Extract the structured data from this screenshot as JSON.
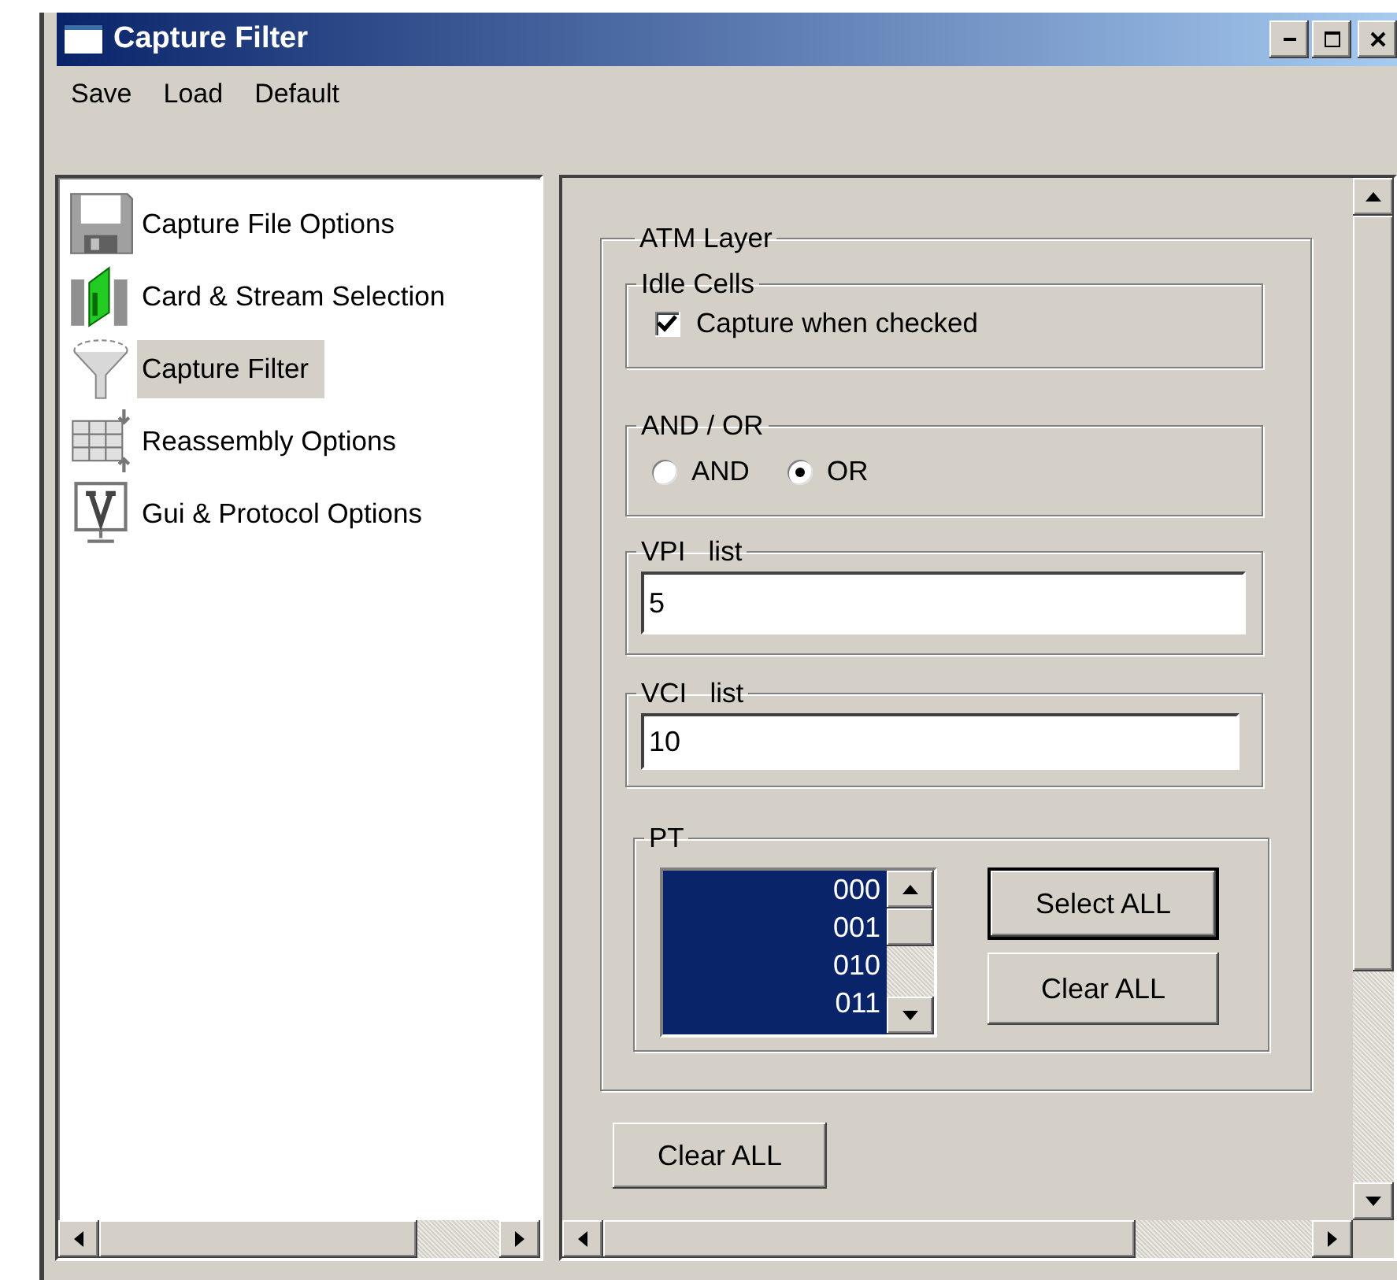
{
  "window": {
    "title": "Capture Filter"
  },
  "menu": [
    {
      "label": "Save"
    },
    {
      "label": "Load"
    },
    {
      "label": "Default"
    }
  ],
  "nav": [
    {
      "label": "Capture File Options",
      "kind": "floppy",
      "selected": false
    },
    {
      "label": "Card & Stream Selection",
      "kind": "cards",
      "selected": false
    },
    {
      "label": "Capture Filter",
      "kind": "funnel",
      "selected": true
    },
    {
      "label": "Reassembly Options",
      "kind": "grid",
      "selected": false
    },
    {
      "label": "Gui & Protocol Options",
      "kind": "monitor",
      "selected": false
    }
  ],
  "atm_layer": {
    "title": "ATM Layer",
    "idle_cells": {
      "title": "Idle Cells",
      "checkbox": {
        "label": "Capture when checked",
        "checked": true
      }
    },
    "and_or": {
      "title": "AND / OR",
      "options": [
        {
          "label": "AND",
          "selected": false
        },
        {
          "label": "OR",
          "selected": true
        }
      ]
    },
    "vpi": {
      "title": "VPI   list",
      "value": "5"
    },
    "vci": {
      "title": "VCI   list",
      "value": "10"
    },
    "pt": {
      "title": "PT",
      "items": [
        {
          "label": "000",
          "selected": true
        },
        {
          "label": "001",
          "selected": true
        },
        {
          "label": "010",
          "selected": true
        },
        {
          "label": "011",
          "selected": true
        }
      ],
      "buttons": [
        {
          "label": "Select ALL",
          "default": true
        },
        {
          "label": "Clear ALL",
          "default": false
        }
      ]
    }
  },
  "clear_all_button": "Clear ALL"
}
